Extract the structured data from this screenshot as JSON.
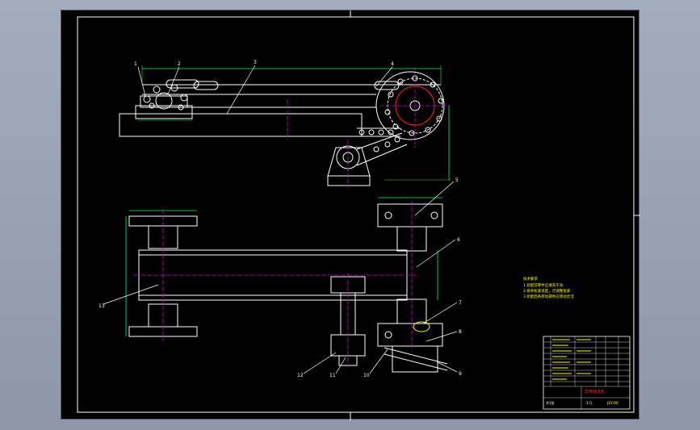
{
  "app": {
    "background_color": "#9aa3b3",
    "canvas_color": "#000000"
  },
  "colors": {
    "outline": "#ffffff",
    "frame": "#ffffff",
    "centerline": "#d000d0",
    "dimension": "#00ff40",
    "leader": "#ffffff",
    "callout": "#ffff00",
    "notes": "#ffff00",
    "accent_red": "#ff2020"
  },
  "callouts": {
    "c1": "1",
    "c2": "2",
    "c3": "3",
    "c4": "4",
    "c5": "5",
    "c6": "6",
    "c7": "7",
    "c8": "8",
    "c9": "9",
    "c10": "10",
    "c11": "11",
    "c12": "12",
    "c13": "13"
  },
  "notes": {
    "heading": "技术要求",
    "line1": "1.装配前零件应清洗干净",
    "line2": "2.链条松紧适度，可调整张紧",
    "line3": "3.装配后各转动部件应转动灵活"
  },
  "title_block": {
    "drawing_title": "皮带输送机",
    "scale": "1:5",
    "sheet": "共1张",
    "drawing_no": "JSY-00"
  }
}
